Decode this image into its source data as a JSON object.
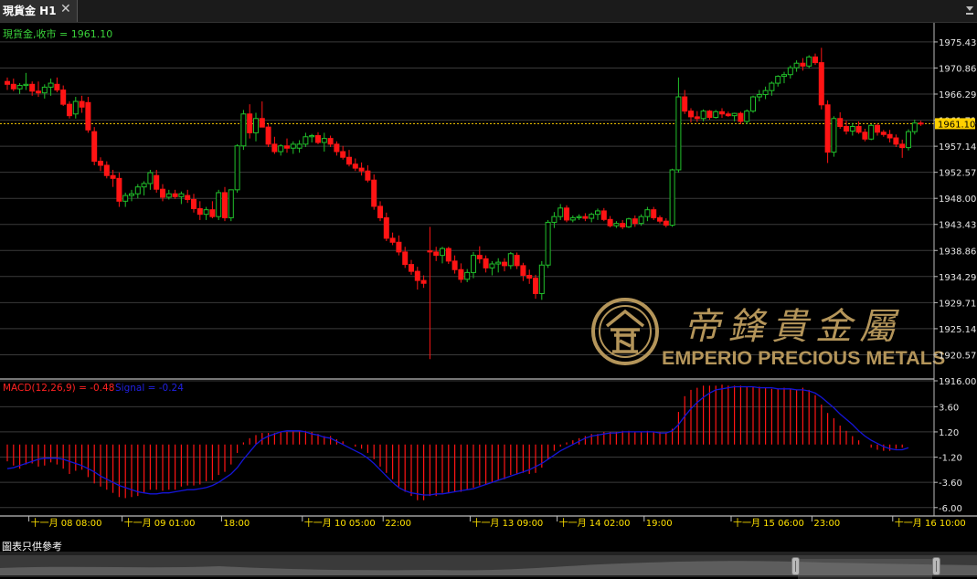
{
  "tab": {
    "label": "現貨金 H1",
    "close_label": "✕"
  },
  "chart_data": {
    "type": "candlestick",
    "symbol_label": "現貨金,收市 = 1961.10",
    "last_price": "1961.10",
    "price_axis_ticks": [
      "1975.43",
      "1970.86",
      "1966.29",
      "1961.71",
      "1957.14",
      "1952.57",
      "1948.00",
      "1943.43",
      "1938.86",
      "1934.29",
      "1929.71",
      "1925.14",
      "1920.57",
      "1916.00"
    ],
    "ylim": [
      1916.0,
      1977.5
    ],
    "candles": [
      [
        1968.5,
        1969.2,
        1967.0,
        1968.0
      ],
      [
        1968.0,
        1969.0,
        1966.8,
        1967.2
      ],
      [
        1967.2,
        1968.2,
        1966.3,
        1967.8
      ],
      [
        1967.8,
        1970.0,
        1967.0,
        1968.0
      ],
      [
        1968.0,
        1968.5,
        1966.0,
        1966.8
      ],
      [
        1966.8,
        1968.5,
        1965.8,
        1966.5
      ],
      [
        1966.5,
        1968.0,
        1965.5,
        1967.5
      ],
      [
        1967.5,
        1969.0,
        1966.0,
        1968.2
      ],
      [
        1968.0,
        1969.2,
        1966.6,
        1967.0
      ],
      [
        1967.0,
        1967.8,
        1964.2,
        1964.5
      ],
      [
        1964.5,
        1965.0,
        1962.0,
        1962.5
      ],
      [
        1962.8,
        1965.8,
        1962.0,
        1965.0
      ],
      [
        1965.0,
        1966.0,
        1963.0,
        1964.0
      ],
      [
        1964.8,
        1965.8,
        1959.5,
        1960.0
      ],
      [
        1959.7,
        1960.5,
        1953.8,
        1954.5
      ],
      [
        1954.5,
        1955.2,
        1952.8,
        1953.8
      ],
      [
        1953.8,
        1954.5,
        1951.5,
        1952.0
      ],
      [
        1952.0,
        1953.0,
        1950.0,
        1951.5
      ],
      [
        1951.5,
        1952.5,
        1946.5,
        1947.5
      ],
      [
        1947.5,
        1949.0,
        1946.5,
        1948.5
      ],
      [
        1948.5,
        1949.5,
        1947.5,
        1948.8
      ],
      [
        1948.8,
        1950.5,
        1948.0,
        1950.0
      ],
      [
        1950.0,
        1951.0,
        1948.5,
        1950.6
      ],
      [
        1950.6,
        1953.0,
        1949.5,
        1952.5
      ],
      [
        1952.0,
        1953.0,
        1949.0,
        1949.6
      ],
      [
        1949.6,
        1950.5,
        1947.5,
        1948.2
      ],
      [
        1948.2,
        1949.5,
        1947.8,
        1948.8
      ],
      [
        1948.8,
        1949.5,
        1947.9,
        1948.3
      ],
      [
        1948.3,
        1949.2,
        1947.0,
        1948.8
      ],
      [
        1948.5,
        1949.5,
        1947.2,
        1947.8
      ],
      [
        1947.8,
        1948.8,
        1945.5,
        1946.2
      ],
      [
        1946.2,
        1947.5,
        1944.2,
        1945.2
      ],
      [
        1945.2,
        1946.5,
        1944.2,
        1946.0
      ],
      [
        1946.0,
        1947.5,
        1944.5,
        1944.8
      ],
      [
        1944.8,
        1949.5,
        1944.2,
        1949.0
      ],
      [
        1949.0,
        1950.0,
        1944.0,
        1944.6
      ],
      [
        1944.6,
        1949.5,
        1944.0,
        1949.5
      ],
      [
        1949.5,
        1957.5,
        1949.0,
        1957.2
      ],
      [
        1957.2,
        1963.5,
        1956.5,
        1962.8
      ],
      [
        1962.8,
        1964.5,
        1958.5,
        1959.5
      ],
      [
        1959.5,
        1963.0,
        1958.0,
        1962.0
      ],
      [
        1962.0,
        1965.0,
        1960.5,
        1960.5
      ],
      [
        1960.5,
        1961.0,
        1957.0,
        1957.5
      ],
      [
        1957.5,
        1958.8,
        1955.8,
        1956.2
      ],
      [
        1956.2,
        1957.5,
        1955.5,
        1957.2
      ],
      [
        1957.2,
        1958.5,
        1956.0,
        1956.8
      ],
      [
        1956.8,
        1958.0,
        1955.8,
        1957.5
      ],
      [
        1956.8,
        1958.2,
        1956.0,
        1957.5
      ],
      [
        1957.5,
        1959.5,
        1957.0,
        1958.8
      ],
      [
        1958.8,
        1959.3,
        1957.8,
        1959.0
      ],
      [
        1959.0,
        1959.6,
        1957.5,
        1957.8
      ],
      [
        1957.8,
        1959.5,
        1956.2,
        1958.5
      ],
      [
        1958.5,
        1959.0,
        1957.0,
        1957.5
      ],
      [
        1957.5,
        1958.0,
        1955.5,
        1956.2
      ],
      [
        1956.2,
        1957.2,
        1954.8,
        1955.2
      ],
      [
        1955.2,
        1956.5,
        1953.6,
        1954.0
      ],
      [
        1954.0,
        1955.0,
        1952.8,
        1953.3
      ],
      [
        1953.3,
        1954.3,
        1952.0,
        1952.8
      ],
      [
        1952.8,
        1953.8,
        1950.8,
        1951.2
      ],
      [
        1951.2,
        1952.2,
        1946.0,
        1946.6
      ],
      [
        1946.6,
        1947.5,
        1944.0,
        1944.6
      ],
      [
        1944.6,
        1945.5,
        1940.5,
        1941.0
      ],
      [
        1941.0,
        1942.0,
        1939.8,
        1940.3
      ],
      [
        1940.3,
        1941.5,
        1938.0,
        1938.6
      ],
      [
        1938.6,
        1939.5,
        1935.8,
        1936.4
      ],
      [
        1936.4,
        1937.2,
        1934.6,
        1935.2
      ],
      [
        1935.2,
        1936.0,
        1932.0,
        1933.6
      ],
      [
        1933.6,
        1934.5,
        1932.3,
        1933.1
      ],
      [
        1938.8,
        1943.0,
        1919.8,
        1938.6
      ],
      [
        1938.6,
        1939.5,
        1937.0,
        1938.0
      ],
      [
        1938.0,
        1939.5,
        1936.6,
        1939.2
      ],
      [
        1939.2,
        1939.5,
        1936.5,
        1937.0
      ],
      [
        1937.0,
        1938.0,
        1934.8,
        1935.5
      ],
      [
        1935.5,
        1936.6,
        1933.2,
        1933.8
      ],
      [
        1933.8,
        1935.6,
        1933.3,
        1935.0
      ],
      [
        1935.0,
        1938.6,
        1934.0,
        1938.0
      ],
      [
        1938.0,
        1939.6,
        1936.6,
        1937.4
      ],
      [
        1937.4,
        1938.0,
        1935.0,
        1935.8
      ],
      [
        1935.8,
        1937.0,
        1934.5,
        1936.5
      ],
      [
        1936.5,
        1937.5,
        1935.0,
        1936.8
      ],
      [
        1936.8,
        1937.5,
        1935.2,
        1936.2
      ],
      [
        1936.2,
        1938.6,
        1935.6,
        1938.3
      ],
      [
        1938.0,
        1938.5,
        1935.6,
        1936.2
      ],
      [
        1936.2,
        1936.7,
        1933.5,
        1934.5
      ],
      [
        1934.5,
        1935.5,
        1933.0,
        1934.0
      ],
      [
        1934.0,
        1934.6,
        1930.4,
        1931.3
      ],
      [
        1931.3,
        1937.0,
        1930.2,
        1936.3
      ],
      [
        1936.3,
        1944.2,
        1935.8,
        1943.8
      ],
      [
        1943.8,
        1945.6,
        1942.8,
        1944.8
      ],
      [
        1944.8,
        1947.0,
        1944.2,
        1946.3
      ],
      [
        1946.3,
        1946.8,
        1943.8,
        1944.2
      ],
      [
        1944.2,
        1945.0,
        1943.8,
        1944.6
      ],
      [
        1944.6,
        1945.2,
        1944.2,
        1944.8
      ],
      [
        1944.8,
        1945.4,
        1944.0,
        1944.5
      ],
      [
        1944.5,
        1945.5,
        1943.8,
        1945.2
      ],
      [
        1945.2,
        1946.2,
        1944.2,
        1945.8
      ],
      [
        1945.8,
        1946.3,
        1944.0,
        1944.3
      ],
      [
        1944.3,
        1944.9,
        1942.9,
        1943.2
      ],
      [
        1943.2,
        1944.0,
        1942.8,
        1943.6
      ],
      [
        1943.6,
        1944.2,
        1942.6,
        1943.0
      ],
      [
        1943.0,
        1944.6,
        1942.8,
        1944.4
      ],
      [
        1944.4,
        1945.0,
        1943.0,
        1943.6
      ],
      [
        1943.6,
        1945.2,
        1943.2,
        1944.8
      ],
      [
        1944.8,
        1946.5,
        1944.0,
        1946.0
      ],
      [
        1946.0,
        1946.5,
        1944.2,
        1944.6
      ],
      [
        1944.6,
        1945.0,
        1943.6,
        1944.0
      ],
      [
        1944.0,
        1944.5,
        1942.9,
        1943.3
      ],
      [
        1943.3,
        1953.2,
        1943.0,
        1953.0
      ],
      [
        1953.0,
        1969.2,
        1952.5,
        1965.8
      ],
      [
        1965.8,
        1967.0,
        1962.8,
        1963.3
      ],
      [
        1963.3,
        1963.8,
        1961.3,
        1962.3
      ],
      [
        1962.3,
        1963.3,
        1961.4,
        1962.0
      ],
      [
        1962.0,
        1963.6,
        1961.5,
        1963.3
      ],
      [
        1963.3,
        1963.5,
        1961.8,
        1962.2
      ],
      [
        1962.2,
        1963.5,
        1962.0,
        1963.2
      ],
      [
        1963.2,
        1963.8,
        1962.1,
        1962.8
      ],
      [
        1962.8,
        1963.2,
        1962.3,
        1962.5
      ],
      [
        1962.5,
        1963.0,
        1961.5,
        1962.9
      ],
      [
        1962.9,
        1963.2,
        1961.0,
        1961.5
      ],
      [
        1961.5,
        1963.6,
        1961.0,
        1963.3
      ],
      [
        1963.3,
        1966.0,
        1963.0,
        1965.8
      ],
      [
        1965.8,
        1967.0,
        1965.0,
        1966.2
      ],
      [
        1966.2,
        1967.6,
        1965.4,
        1966.9
      ],
      [
        1966.9,
        1968.5,
        1966.0,
        1968.2
      ],
      [
        1968.2,
        1969.6,
        1967.6,
        1969.4
      ],
      [
        1969.4,
        1970.2,
        1968.2,
        1969.7
      ],
      [
        1969.7,
        1971.3,
        1969.0,
        1970.9
      ],
      [
        1970.9,
        1972.2,
        1970.2,
        1971.7
      ],
      [
        1971.7,
        1972.6,
        1970.4,
        1971.2
      ],
      [
        1971.2,
        1973.1,
        1970.8,
        1972.8
      ],
      [
        1972.8,
        1973.4,
        1971.4,
        1971.8
      ],
      [
        1971.8,
        1974.4,
        1963.6,
        1964.4
      ],
      [
        1964.4,
        1965.2,
        1954.2,
        1956.1
      ],
      [
        1956.1,
        1962.4,
        1955.3,
        1962.0
      ],
      [
        1962.0,
        1963.1,
        1960.2,
        1960.6
      ],
      [
        1960.6,
        1961.6,
        1959.2,
        1959.8
      ],
      [
        1959.8,
        1961.2,
        1959.0,
        1960.6
      ],
      [
        1960.6,
        1961.5,
        1959.3,
        1959.6
      ],
      [
        1959.6,
        1960.2,
        1958.0,
        1958.4
      ],
      [
        1958.4,
        1961.0,
        1958.2,
        1960.8
      ],
      [
        1960.8,
        1961.1,
        1959.0,
        1959.6
      ],
      [
        1959.6,
        1960.0,
        1958.8,
        1959.2
      ],
      [
        1959.2,
        1960.0,
        1957.8,
        1958.6
      ],
      [
        1958.6,
        1959.2,
        1957.0,
        1957.5
      ],
      [
        1957.5,
        1958.3,
        1955.1,
        1956.9
      ],
      [
        1956.9,
        1960.1,
        1956.4,
        1959.7
      ],
      [
        1959.7,
        1961.8,
        1959.2,
        1961.2
      ],
      [
        1961.2,
        1961.6,
        1960.7,
        1961.1
      ]
    ],
    "macd": {
      "label": "MACD(12,26,9) = -0.48",
      "signal_label": "Signal = -0.24",
      "axis_ticks": [
        "3.60",
        "1.20",
        "-1.20",
        "-3.60",
        "-6.00"
      ],
      "ylim": [
        -6.8,
        5.8
      ],
      "histogram": [
        -1.6,
        -2.0,
        -2.3,
        -1.9,
        -1.8,
        -2.1,
        -2.0,
        -1.7,
        -1.9,
        -2.3,
        -2.8,
        -2.5,
        -2.4,
        -3.1,
        -3.7,
        -4.0,
        -4.3,
        -4.6,
        -5.0,
        -5.1,
        -5.0,
        -4.9,
        -4.6,
        -4.3,
        -4.3,
        -4.4,
        -4.3,
        -4.3,
        -4.0,
        -3.9,
        -3.9,
        -3.8,
        -3.5,
        -3.4,
        -2.9,
        -2.6,
        -1.9,
        -0.8,
        0.2,
        0.6,
        0.9,
        1.1,
        1.1,
        1.1,
        1.2,
        1.2,
        1.3,
        1.3,
        1.3,
        1.2,
        1.0,
        0.8,
        0.8,
        0.5,
        0.3,
        0.0,
        -0.2,
        -0.4,
        -0.8,
        -1.4,
        -2.1,
        -2.7,
        -3.3,
        -4.0,
        -4.5,
        -4.9,
        -5.3,
        -5.3,
        -4.9,
        -4.9,
        -4.6,
        -4.6,
        -4.5,
        -4.5,
        -4.3,
        -4.1,
        -3.9,
        -3.8,
        -3.6,
        -3.4,
        -3.3,
        -2.9,
        -2.8,
        -2.7,
        -2.8,
        -2.7,
        -2.2,
        -1.4,
        -0.6,
        -0.2,
        0.2,
        0.4,
        0.6,
        0.8,
        1.0,
        1.0,
        1.2,
        1.2,
        1.2,
        1.3,
        1.3,
        1.2,
        1.2,
        1.3,
        1.2,
        1.2,
        1.1,
        1.5,
        3.1,
        4.6,
        5.2,
        5.4,
        5.6,
        5.6,
        5.6,
        5.7,
        5.6,
        5.6,
        5.6,
        5.5,
        5.5,
        5.5,
        5.4,
        5.3,
        5.3,
        5.4,
        5.3,
        5.2,
        5.4,
        5.2,
        4.7,
        3.8,
        3.0,
        2.5,
        1.8,
        1.3,
        0.8,
        0.4,
        0.0,
        -0.3,
        -0.5,
        -0.6,
        -0.6,
        -0.4,
        -0.3
      ],
      "signal": [
        -2.3,
        -2.2,
        -2.0,
        -1.8,
        -1.6,
        -1.4,
        -1.3,
        -1.3,
        -1.3,
        -1.4,
        -1.6,
        -1.8,
        -2.0,
        -2.3,
        -2.6,
        -3.0,
        -3.3,
        -3.6,
        -3.9,
        -4.1,
        -4.3,
        -4.5,
        -4.6,
        -4.7,
        -4.7,
        -4.6,
        -4.6,
        -4.5,
        -4.4,
        -4.3,
        -4.3,
        -4.2,
        -4.1,
        -3.9,
        -3.6,
        -3.2,
        -2.8,
        -2.2,
        -1.4,
        -0.7,
        0.0,
        0.5,
        0.8,
        1.0,
        1.2,
        1.3,
        1.3,
        1.3,
        1.2,
        1.0,
        0.9,
        0.7,
        0.6,
        0.3,
        0.0,
        -0.3,
        -0.6,
        -0.9,
        -1.3,
        -1.8,
        -2.4,
        -3.0,
        -3.6,
        -4.1,
        -4.4,
        -4.6,
        -4.7,
        -4.8,
        -4.8,
        -4.7,
        -4.7,
        -4.6,
        -4.5,
        -4.4,
        -4.3,
        -4.2,
        -4.0,
        -3.8,
        -3.6,
        -3.4,
        -3.2,
        -3.0,
        -2.8,
        -2.6,
        -2.4,
        -2.1,
        -1.8,
        -1.4,
        -1.0,
        -0.6,
        -0.3,
        0.0,
        0.3,
        0.6,
        0.8,
        0.9,
        1.0,
        1.1,
        1.1,
        1.2,
        1.2,
        1.2,
        1.2,
        1.2,
        1.2,
        1.1,
        1.1,
        1.3,
        1.9,
        2.7,
        3.4,
        4.0,
        4.5,
        4.9,
        5.2,
        5.3,
        5.4,
        5.5,
        5.5,
        5.5,
        5.5,
        5.4,
        5.4,
        5.4,
        5.3,
        5.3,
        5.3,
        5.2,
        5.2,
        5.1,
        4.9,
        4.5,
        4.0,
        3.5,
        2.9,
        2.4,
        1.9,
        1.3,
        0.8,
        0.4,
        0.1,
        -0.2,
        -0.4,
        -0.5,
        -0.5,
        -0.3
      ]
    },
    "time_labels": [
      "十一月 08 08:00",
      "十一月 09 01:00",
      "18:00",
      "十一月 10 05:00",
      "22:00",
      "十一月 13 09:00",
      "十一月 14 02:00",
      "19:00",
      "十一月 15 06:00",
      "23:00",
      "十一月 16 10:00"
    ],
    "time_label_index": [
      2,
      17,
      33,
      46,
      59,
      73,
      87,
      101,
      115,
      128,
      141
    ],
    "colors": {
      "bull": "#21c12b",
      "bear": "#ff1414",
      "signal": "#1515d8",
      "grid": "#3a3a3a",
      "axis_text": "#e6e6e6",
      "last_price": "#ffd000",
      "time_text": "#ffe100",
      "symbol_text": "#3ad33a"
    }
  },
  "watermark": {
    "chinese": "帝鋒貴金屬",
    "english": "EMPERIO PRECIOUS METALS"
  },
  "footer": {
    "note": "圖表只供參考"
  }
}
